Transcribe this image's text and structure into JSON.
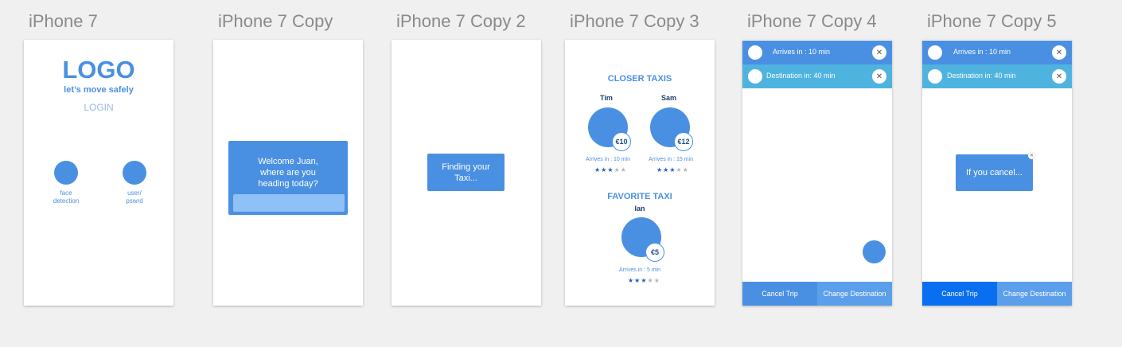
{
  "artboards": [
    {
      "label": "iPhone 7"
    },
    {
      "label": "iPhone 7 Copy"
    },
    {
      "label": "iPhone 7 Copy 2"
    },
    {
      "label": "iPhone 7 Copy 3"
    },
    {
      "label": "iPhone 7 Copy 4"
    },
    {
      "label": "iPhone 7 Copy 5"
    }
  ],
  "login_screen": {
    "logo": "LOGO",
    "tagline": "let’s move safely",
    "login": "LOGIN",
    "face_label_1": "face",
    "face_label_2": "detection",
    "user_label_1": "user/",
    "user_label_2": "pswrd"
  },
  "welcome_screen": {
    "line1": "Welcome Juan,",
    "line2": "where are you",
    "line3": "heading today?"
  },
  "finding_screen": {
    "line1": "Finding your",
    "line2": "Taxi..."
  },
  "taxis_screen": {
    "closer_title": "CLOSER TAXIS",
    "favorite_title": "FAVORITE TAXI",
    "drivers": [
      {
        "name": "Tim",
        "price": "€10",
        "arrives": "Arrives in : 10 min",
        "rating": 3
      },
      {
        "name": "Sam",
        "price": "€12",
        "arrives": "Arrives in : 15 min",
        "rating": 3
      },
      {
        "name": "Ian",
        "price": "€5",
        "arrives": "Arrives in : 5 min",
        "rating": 3
      }
    ]
  },
  "trip_screen": {
    "arrives": "Arrives in : 10 min",
    "destination": "Destination in: 40 min",
    "cancel_trip": "Cancel Trip",
    "change_destination": "Change Destination",
    "cancel_prompt": "If you cancel...",
    "close_glyph": "✕"
  },
  "colors": {
    "primary": "#4a90e2",
    "light_blue": "#4fb3e0",
    "dark_blue": "#0a6ef0"
  }
}
